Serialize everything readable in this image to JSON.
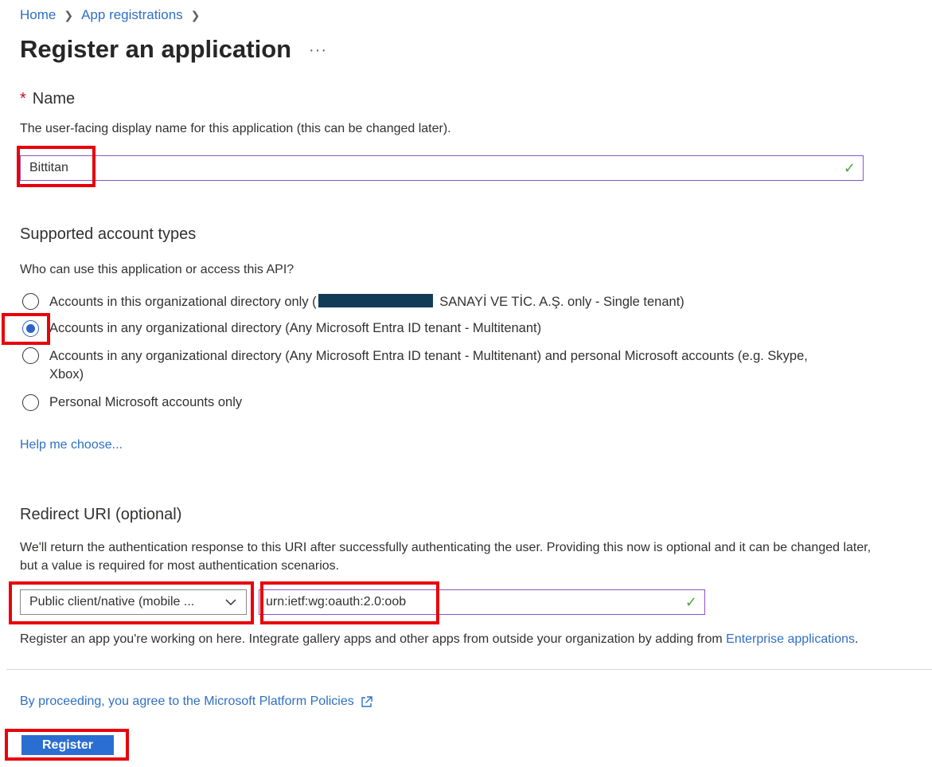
{
  "breadcrumb": {
    "home": "Home",
    "app_registrations": "App registrations",
    "separator": ">"
  },
  "page": {
    "title": "Register an application",
    "more_label": "···"
  },
  "name_section": {
    "required_marker": "*",
    "label": "Name",
    "description": "The user-facing display name for this application (this can be changed later).",
    "value": "Bittitan",
    "valid_icon": "checkmark-icon"
  },
  "account_types": {
    "heading": "Supported account types",
    "question": "Who can use this application or access this API?",
    "options": [
      {
        "label_prefix": "Accounts in this organizational directory only (",
        "label_suffix": " SANAYİ VE TİC. A.Ş. only - Single tenant)",
        "selected": false
      },
      {
        "label": "Accounts in any organizational directory (Any Microsoft Entra ID tenant - Multitenant)",
        "selected": true
      },
      {
        "label": "Accounts in any organizational directory (Any Microsoft Entra ID tenant - Multitenant) and personal Microsoft accounts (e.g. Skype, Xbox)",
        "selected": false
      },
      {
        "label": "Personal Microsoft accounts only",
        "selected": false
      }
    ],
    "help_link": "Help me choose..."
  },
  "redirect": {
    "heading": "Redirect URI (optional)",
    "description": "We'll return the authentication response to this URI after successfully authenticating the user. Providing this now is optional and it can be changed later, but a value is required for most authentication scenarios.",
    "platform_selected": "Public client/native (mobile ...",
    "uri_value": "urn:ietf:wg:oauth:2.0:oob",
    "note_text": "Register an app you're working on here. Integrate gallery apps and other apps from outside your organization by adding from ",
    "note_link": "Enterprise applications",
    "note_end": "."
  },
  "footer": {
    "policy_link": "By proceeding, you agree to the Microsoft Platform Policies",
    "register_label": "Register"
  },
  "colors": {
    "accent": "#2b6ed1",
    "link": "#2f6fc5",
    "highlight": "#e8000b",
    "valid": "#4aa53f"
  }
}
